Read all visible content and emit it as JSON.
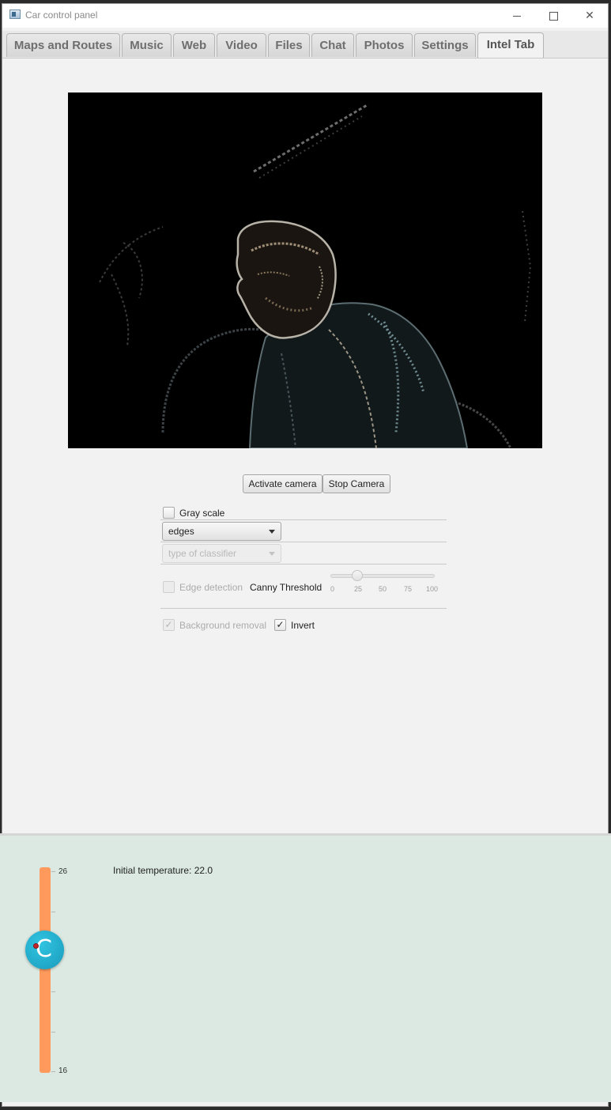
{
  "window": {
    "title": "Car control panel",
    "controls": {
      "minimize": "minimize",
      "maximize": "maximize",
      "close": "✕"
    }
  },
  "tabs": [
    {
      "label": "Maps and Routes"
    },
    {
      "label": "Music"
    },
    {
      "label": "Web"
    },
    {
      "label": "Video"
    },
    {
      "label": "Files"
    },
    {
      "label": "Chat"
    },
    {
      "label": "Photos"
    },
    {
      "label": "Settings"
    },
    {
      "label": "Intel Tab",
      "active": true
    }
  ],
  "camera": {
    "feed_description": "edge-filtered inverted camera frame",
    "activate_label": "Activate camera",
    "stop_label": "Stop Camera"
  },
  "filters": {
    "gray_scale": {
      "label": "Gray scale",
      "checked": false
    },
    "filter_select": {
      "value": "edges"
    },
    "classifier_select": {
      "placeholder": "type of classifier",
      "enabled": false
    },
    "edge_detection": {
      "label": "Edge detection",
      "checked": false,
      "enabled": false
    },
    "canny": {
      "label": "Canny Threshold",
      "value": 25,
      "min": 0,
      "max": 100,
      "ticks": [
        "0",
        "25",
        "50",
        "75",
        "100"
      ]
    },
    "background_removal": {
      "label": "Background removal",
      "checked": true,
      "enabled": false
    },
    "invert": {
      "label": "Invert",
      "checked": true
    }
  },
  "temperature": {
    "initial_label": "Initial temperature: 22.0",
    "max_label": "26",
    "min_label": "16",
    "knob_symbol": "C",
    "bar_color": "#ff9a5c",
    "knob_color": "#27b4d4",
    "panel_color": "#dbe9e2"
  }
}
